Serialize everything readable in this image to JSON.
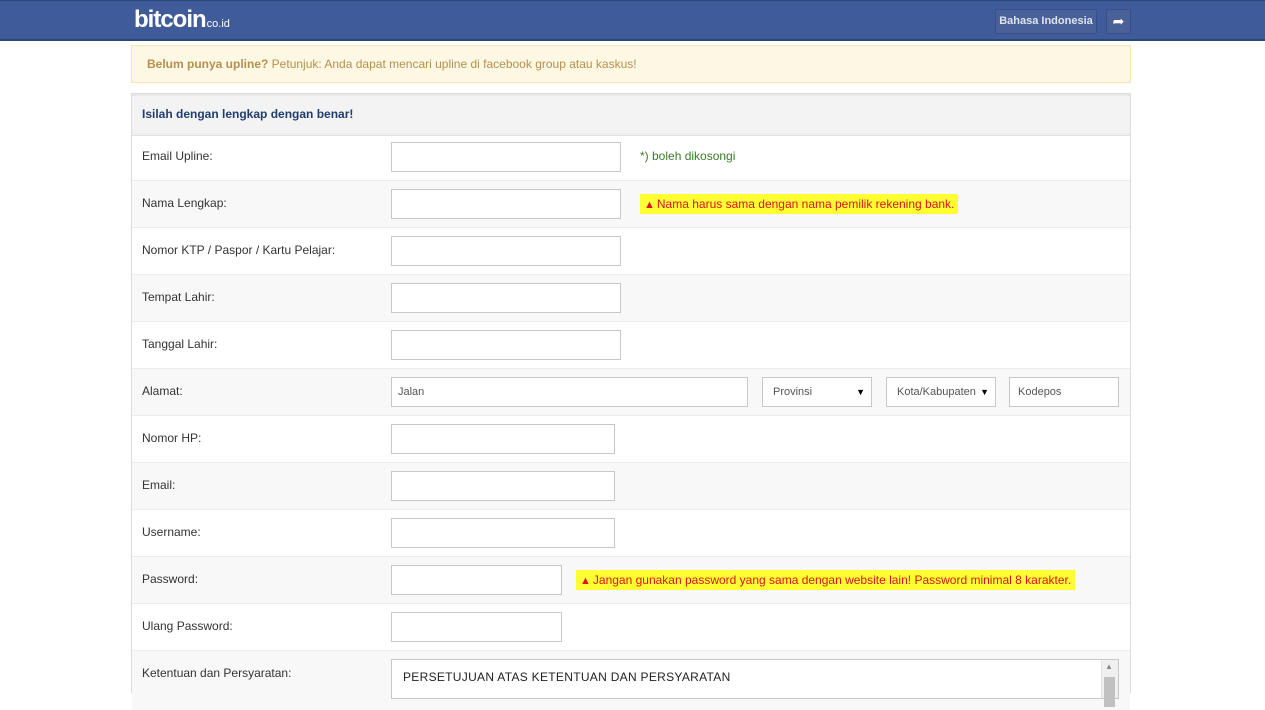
{
  "header": {
    "logo_text": "bitcoin",
    "logo_suffix": "co.id",
    "language_button": "Bahasa Indonesia",
    "redirect_icon": "share-icon"
  },
  "notice": {
    "bold": "Belum punya upline?",
    "text": " Petunjuk: Anda dapat mencari upline di facebook group atau kaskus!"
  },
  "form": {
    "title": "Isilah dengan lengkap dengan benar!",
    "email_upline": {
      "label": "Email Upline:",
      "value": "",
      "hint": "*) boleh dikosongi"
    },
    "full_name": {
      "label": "Nama Lengkap:",
      "value": "",
      "warning": "Nama harus sama dengan nama pemilik rekening bank."
    },
    "id_number": {
      "label": "Nomor KTP / Paspor / Kartu Pelajar:",
      "value": ""
    },
    "birth_place": {
      "label": "Tempat Lahir:",
      "value": ""
    },
    "birth_date": {
      "label": "Tanggal Lahir:",
      "value": ""
    },
    "address": {
      "label": "Alamat:",
      "street_placeholder": "Jalan",
      "province_selected": "Provinsi",
      "city_selected": "Kota/Kabupaten",
      "postal_placeholder": "Kodepos"
    },
    "phone": {
      "label": "Nomor HP:",
      "value": ""
    },
    "email": {
      "label": "Email:",
      "value": ""
    },
    "username": {
      "label": "Username:",
      "value": ""
    },
    "password": {
      "label": "Password:",
      "value": "",
      "warning": "Jangan gunakan password yang sama dengan website lain! Password minimal 8 karakter."
    },
    "password_repeat": {
      "label": "Ulang Password:",
      "value": ""
    },
    "terms": {
      "label": "Ketentuan dan Persyaratan:",
      "title": "PERSETUJUAN ATAS KETENTUAN DAN PERSYARATAN"
    }
  },
  "colors": {
    "header_bg": "#3f5b99",
    "notice_bg": "#fcf8e3",
    "warning_bg": "#ffff33",
    "warning_text": "#d9141c",
    "hint_text": "#3a7a2a"
  }
}
